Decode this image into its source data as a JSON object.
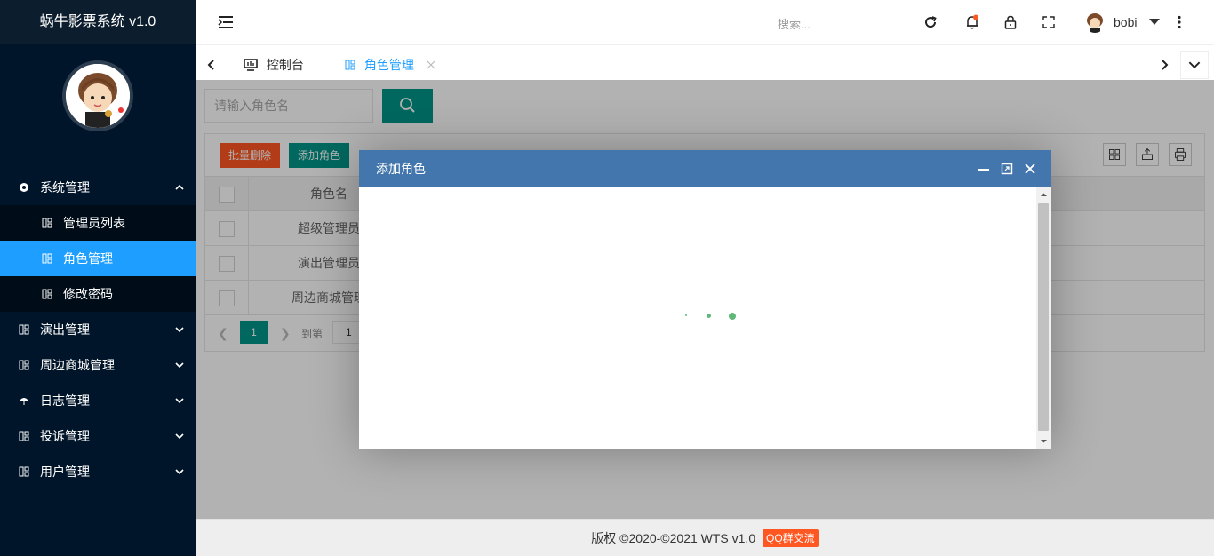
{
  "app": {
    "title": "蜗牛影票系统 v1.0"
  },
  "sidebar": {
    "menu": [
      {
        "label": "系统管理",
        "expanded": true,
        "icon": "globe-icon",
        "children": [
          {
            "label": "管理员列表",
            "active": false
          },
          {
            "label": "角色管理",
            "active": true
          },
          {
            "label": "修改密码",
            "active": false
          }
        ]
      },
      {
        "label": "演出管理",
        "icon": "grid-icon"
      },
      {
        "label": "周边商城管理",
        "icon": "grid-icon"
      },
      {
        "label": "日志管理",
        "icon": "umbrella-icon"
      },
      {
        "label": "投诉管理",
        "icon": "grid-icon"
      },
      {
        "label": "用户管理",
        "icon": "grid-icon"
      }
    ]
  },
  "header": {
    "search_placeholder": "搜索...",
    "username": "bobi",
    "icons": [
      "menu-fold-icon",
      "refresh-icon",
      "bell-icon",
      "lock-icon",
      "fullscreen-icon",
      "more-vertical-icon"
    ]
  },
  "tabs": {
    "items": [
      {
        "label": "控制台",
        "icon": "dashboard-icon"
      },
      {
        "label": "角色管理",
        "icon": "grid-icon",
        "active": true
      }
    ]
  },
  "content": {
    "search": {
      "placeholder": "请输入角色名"
    },
    "toolbar": {
      "batch_delete": "批量删除",
      "add_role": "添加角色"
    },
    "table": {
      "header": "角色名",
      "rows": [
        "超级管理员",
        "演出管理员",
        "周边商城管理"
      ]
    },
    "pager": {
      "current": "1",
      "goto_label": "到第",
      "goto_value": "1"
    }
  },
  "modal": {
    "title": "添加角色"
  },
  "footer": {
    "text": "版权 ©2020-©2021 WTS v1.0",
    "badge": "QQ群交流"
  },
  "colors": {
    "sidebar_bg": "#001529",
    "accent": "#1e9fff",
    "green": "#009688",
    "red": "#ff5722",
    "modal_title_bg": "#4376ad"
  }
}
